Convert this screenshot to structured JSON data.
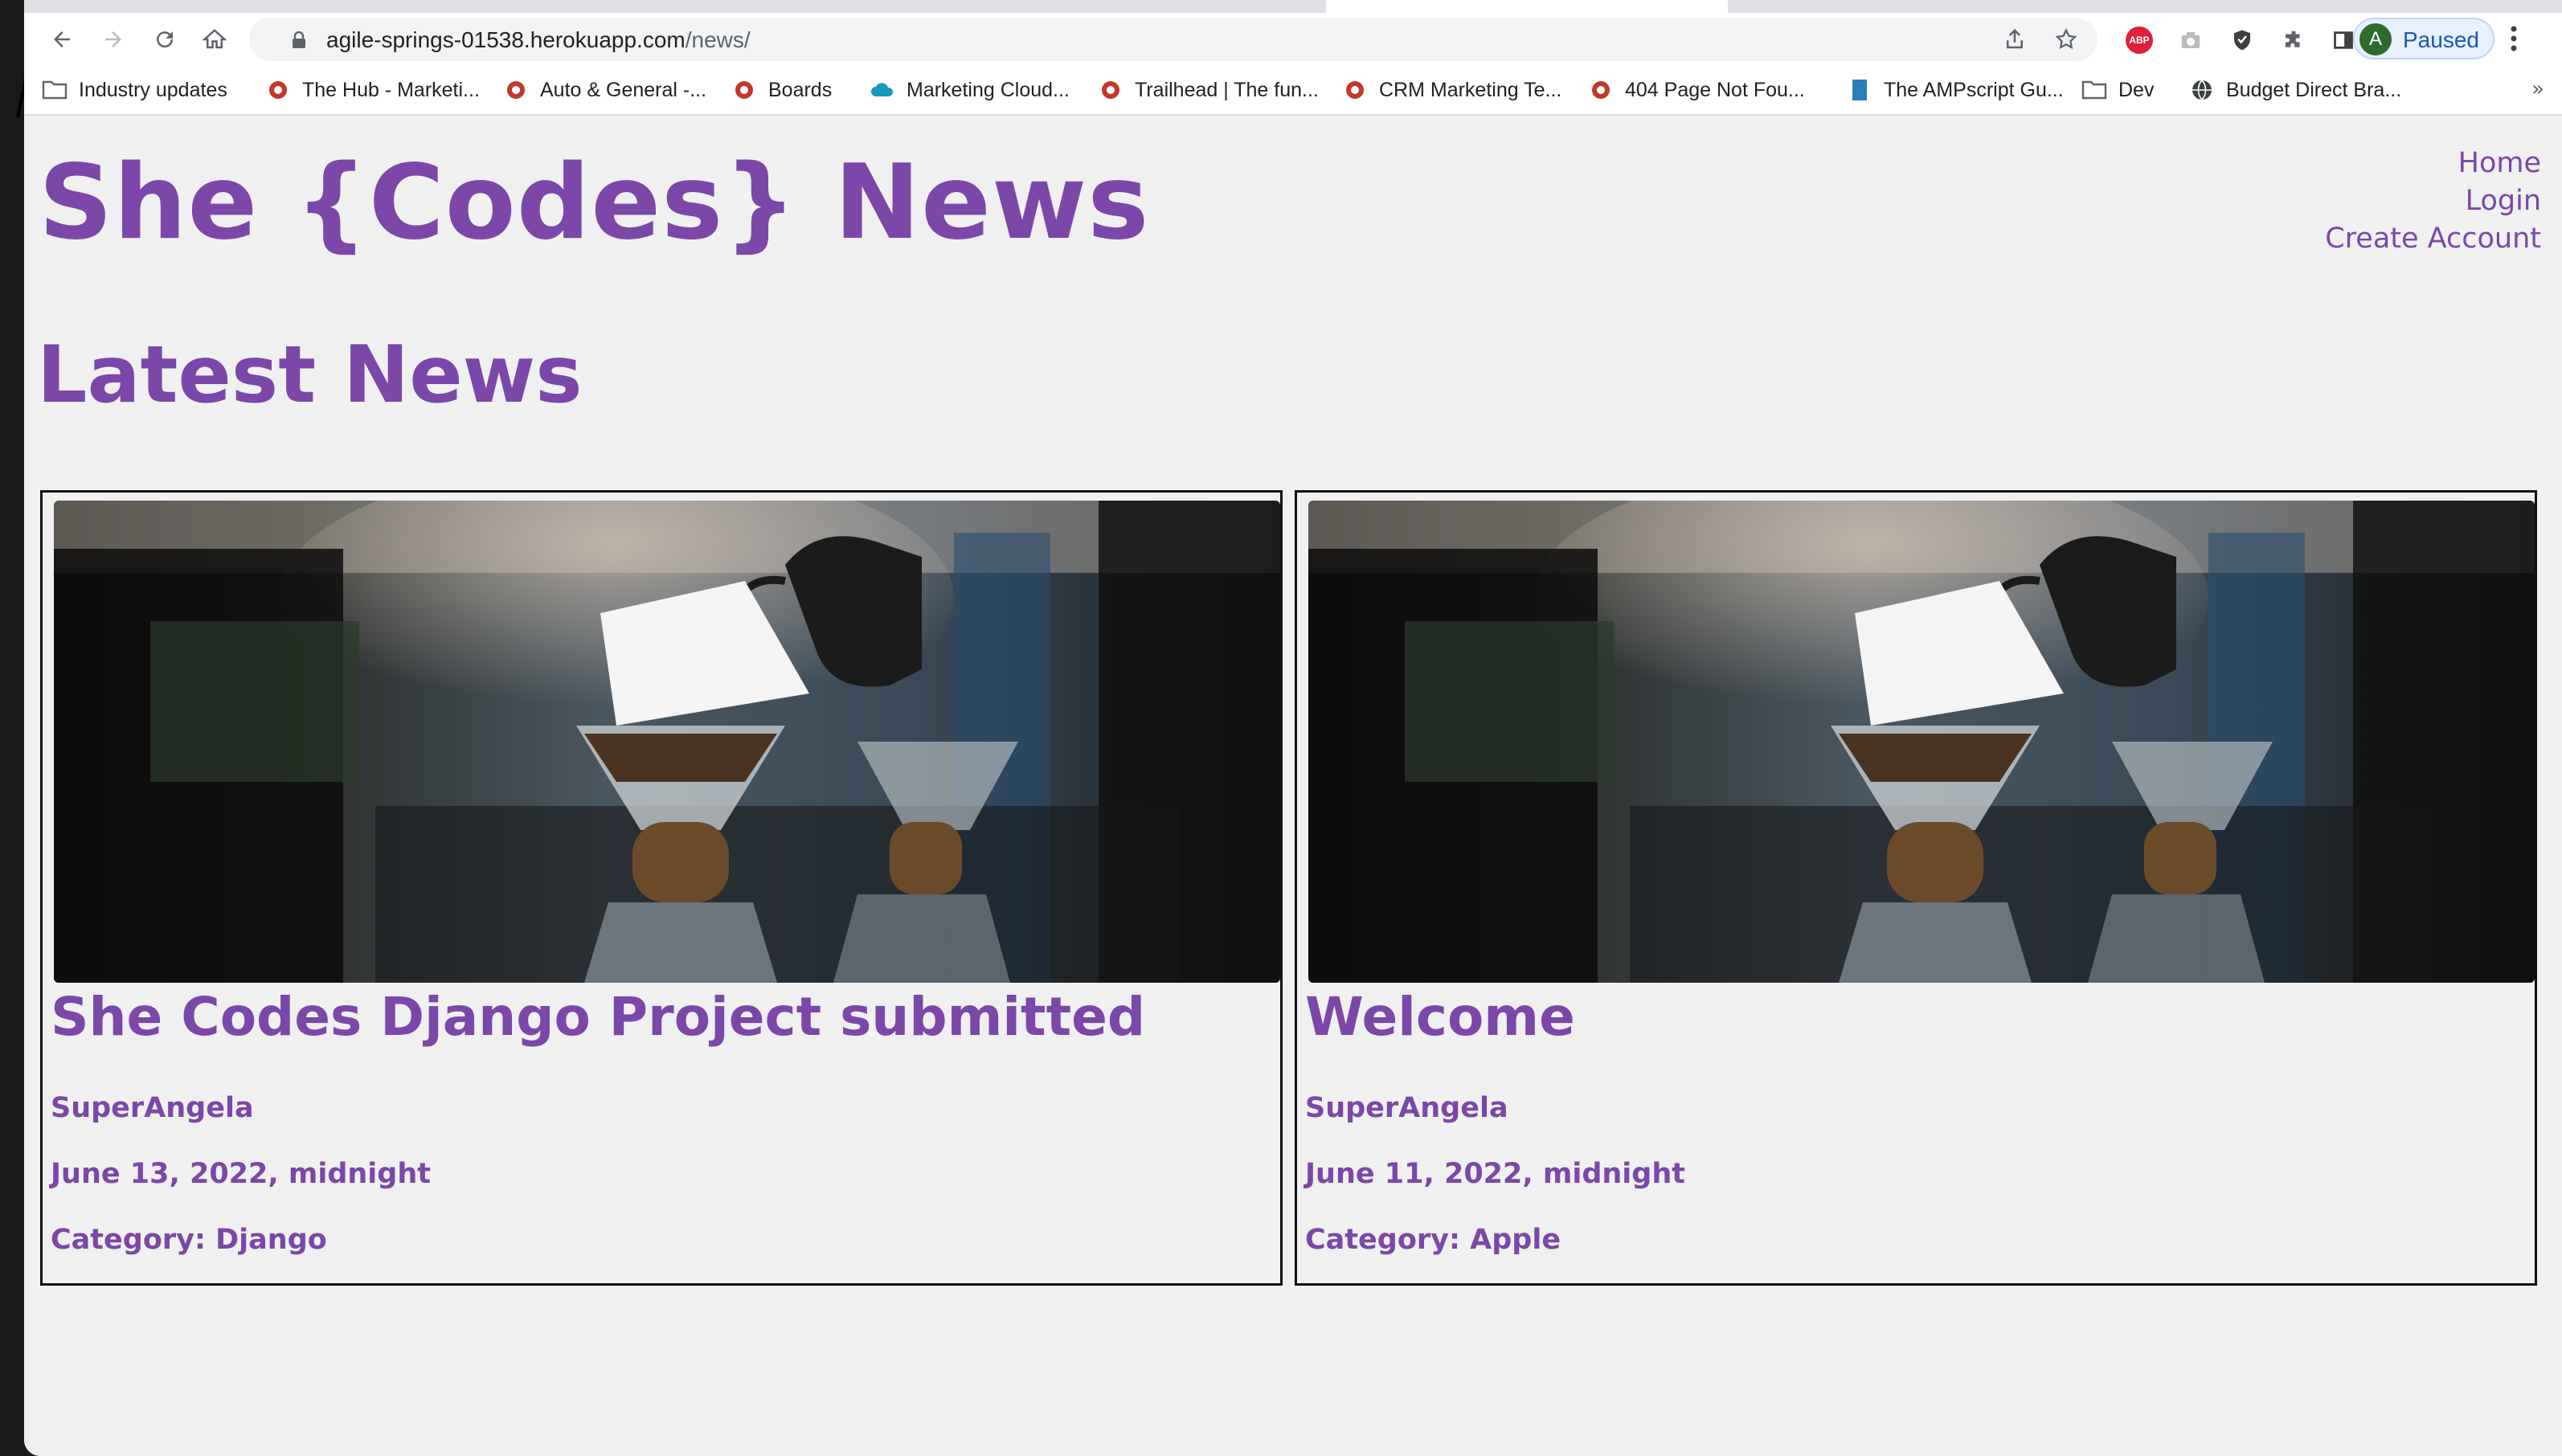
{
  "browser": {
    "url_host": "agile-springs-01538.herokuapp.com",
    "url_path": "/news/",
    "profile_initial": "A",
    "profile_status": "Paused",
    "extensions": [
      "adblock-plus-icon",
      "camera-icon",
      "shield-icon",
      "puzzle-icon",
      "side-panel-icon"
    ]
  },
  "bookmarks": [
    {
      "label": "Industry updates",
      "icon": "folder-icon"
    },
    {
      "label": "The Hub - Marketi...",
      "icon": "site-favicon"
    },
    {
      "label": "Auto & General -...",
      "icon": "site-favicon"
    },
    {
      "label": "Boards",
      "icon": "site-favicon"
    },
    {
      "label": "Marketing Cloud...",
      "icon": "cloud-icon"
    },
    {
      "label": "Trailhead | The fun...",
      "icon": "site-favicon"
    },
    {
      "label": "CRM Marketing Te...",
      "icon": "site-favicon"
    },
    {
      "label": "404 Page Not Fou...",
      "icon": "site-favicon"
    },
    {
      "label": "The AMPscript Gu...",
      "icon": "book-icon"
    },
    {
      "label": "Dev",
      "icon": "folder-icon"
    },
    {
      "label": "Budget Direct Bra...",
      "icon": "globe-icon"
    }
  ],
  "bookmarks_more": "»",
  "site": {
    "title": "She {Codes} News",
    "nav": [
      "Home",
      "Login",
      "Create Account"
    ]
  },
  "section_title": "Latest News",
  "stories": [
    {
      "title": "She Codes Django Project submitted",
      "author": "SuperAngela",
      "date": "June 13, 2022, midnight",
      "category": "Category: Django"
    },
    {
      "title": "Welcome",
      "author": "SuperAngela",
      "date": "June 11, 2022, midnight",
      "category": "Category: Apple"
    }
  ],
  "colors": {
    "accent": "#7b47a8",
    "page_bg": "#f0f0f0"
  }
}
